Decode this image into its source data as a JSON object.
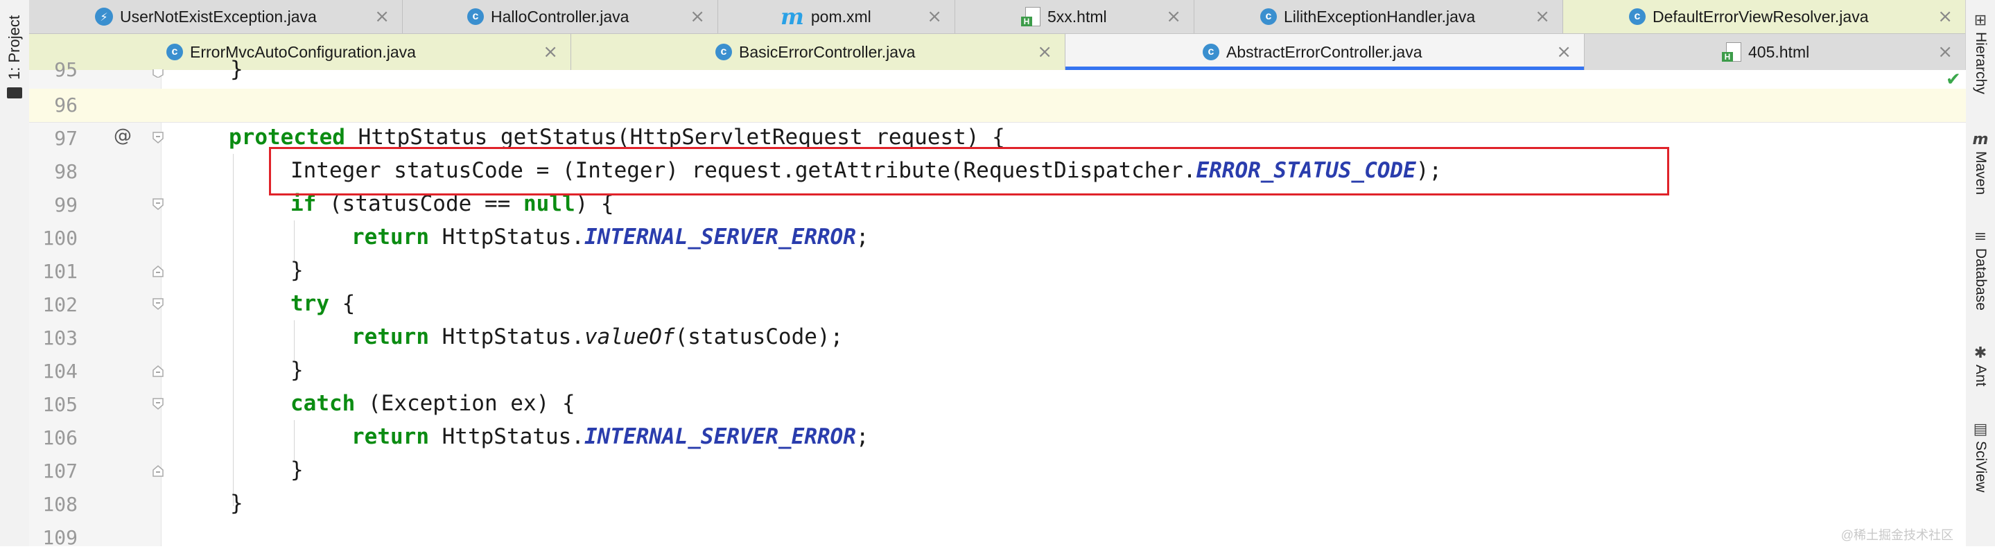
{
  "left_panel": {
    "project_label": "1: Project"
  },
  "tabs_row1": [
    {
      "label": "UserNotExistException.java",
      "icon": "exception-class-icon",
      "bg": "#dcdcdc"
    },
    {
      "label": "HalloController.java",
      "icon": "class-icon"
    },
    {
      "label": "pom.xml",
      "icon": "maven-icon"
    },
    {
      "label": "5xx.html",
      "icon": "html-file-icon"
    },
    {
      "label": "LilithExceptionHandler.java",
      "icon": "class-icon"
    },
    {
      "label": "DefaultErrorViewResolver.java",
      "icon": "class-icon",
      "highlighted": true
    }
  ],
  "tabs_row2": [
    {
      "label": "ErrorMvcAutoConfiguration.java",
      "icon": "class-icon",
      "highlighted": true
    },
    {
      "label": "BasicErrorController.java",
      "icon": "class-icon",
      "highlighted": true
    },
    {
      "label": "AbstractErrorController.java",
      "icon": "class-icon",
      "active": true
    },
    {
      "label": "405.html",
      "icon": "html-file-icon"
    }
  ],
  "right_tools": [
    {
      "label": "Hierarchy",
      "icon": "hierarchy-icon"
    },
    {
      "label": "Maven",
      "icon": "maven-icon"
    },
    {
      "label": "Database",
      "icon": "database-icon"
    },
    {
      "label": "Ant",
      "icon": "ant-icon"
    },
    {
      "label": "SciView",
      "icon": "sciview-icon"
    }
  ],
  "line_numbers": [
    "95",
    "96",
    "97",
    "98",
    "99",
    "100",
    "101",
    "102",
    "103",
    "104",
    "105",
    "106",
    "107",
    "108",
    "109"
  ],
  "override_marker": "@",
  "code": {
    "l95": "}",
    "l97": {
      "kw": "protected",
      "rest": " HttpStatus getStatus(HttpServletRequest request) {"
    },
    "l98": {
      "a": "Integer statusCode = (Integer) request.getAttribute(RequestDispatcher.",
      "const": "ERROR_STATUS_CODE",
      "b": ");"
    },
    "l99": {
      "kw1": "if",
      "a": " (statusCode == ",
      "kw2": "null",
      "b": ") {"
    },
    "l100": {
      "kw": "return",
      "a": " HttpStatus.",
      "const": "INTERNAL_SERVER_ERROR",
      "b": ";"
    },
    "l101": "}",
    "l102": {
      "kw": "try",
      "rest": " {"
    },
    "l103": {
      "kw": "return",
      "a": " HttpStatus.",
      "meth": "valueOf",
      "b": "(statusCode);"
    },
    "l104": "}",
    "l105": {
      "kw": "catch",
      "rest": " (Exception ex) {"
    },
    "l106": {
      "kw": "return",
      "a": " HttpStatus.",
      "const": "INTERNAL_SERVER_ERROR",
      "b": ";"
    },
    "l107": "}",
    "l108": "}"
  },
  "watermark": "@稀土掘金技术社区",
  "colors": {
    "keyword": "#0b8c12",
    "constant": "#2a3dad",
    "highlight_box": "#e0232a",
    "active_tab_underline": "#3574f0"
  }
}
